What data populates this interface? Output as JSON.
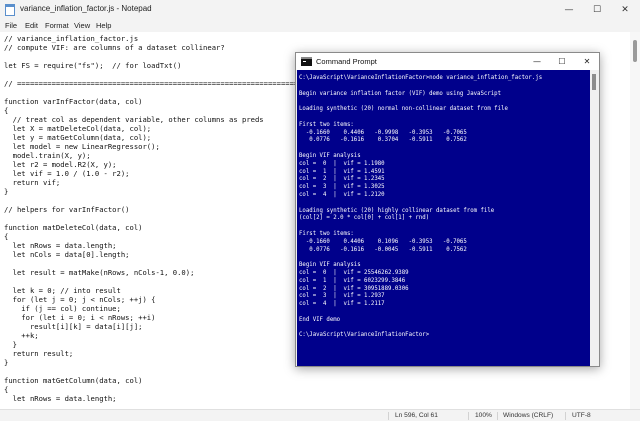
{
  "notepad": {
    "title": "variance_inflation_factor.js - Notepad",
    "menu": [
      "File",
      "Edit",
      "Format",
      "View",
      "Help"
    ],
    "code_lines": [
      "// variance_inflation_factor.js",
      "// compute VIF: are columns of a dataset collinear?",
      "",
      "let FS = require(\"fs\");  // for loadTxt()",
      "",
      "// =================================================================",
      "",
      "function varInfFactor(data, col)",
      "{",
      "  // treat col as dependent variable, other columns as preds",
      "  let X = matDeleteCol(data, col);",
      "  let y = matGetColumn(data, col);",
      "  let model = new LinearRegressor();",
      "  model.train(X, y);",
      "  let r2 = model.R2(X, y);",
      "  let vif = 1.0 / (1.0 - r2);",
      "  return vif;",
      "}",
      "",
      "// helpers for varInfFactor()",
      "",
      "function matDeleteCol(data, col)",
      "{",
      "  let nRows = data.length;",
      "  let nCols = data[0].length;",
      "",
      "  let result = matMake(nRows, nCols-1, 0.0);",
      "",
      "  let k = 0; // into result",
      "  for (let j = 0; j < nCols; ++j) {",
      "    if (j == col) continue;",
      "    for (let i = 0; i < nRows; ++i)",
      "      result[i][k] = data[i][j];",
      "    ++k;",
      "  }",
      "  return result;",
      "}",
      "",
      "function matGetColumn(data, col)",
      "{",
      "  let nRows = data.length;"
    ],
    "status": {
      "position": "Ln 596, Col 61",
      "zoom": "100%",
      "line_ending": "Windows (CRLF)",
      "encoding": "UTF-8"
    },
    "buttons": {
      "minimize": "—",
      "maximize": "☐",
      "close": "✕"
    }
  },
  "cmd": {
    "title": "Command Prompt",
    "console_lines": [
      "C:\\JavaScript\\VarianceInflationFactor>node variance_inflation_factor.js",
      "",
      "Begin variance inflation factor (VIF) demo using JavaScript",
      "",
      "Loading synthetic (20) normal non-collinear dataset from file",
      "",
      "First two items:",
      "  -0.1660    0.4406   -0.9998   -0.3953   -0.7065",
      "   0.0776   -0.1616    0.3704   -0.5911    0.7562",
      "",
      "Begin VIF analysis",
      "col =  0  |  vif = 1.1980",
      "col =  1  |  vif = 1.4591",
      "col =  2  |  vif = 1.2345",
      "col =  3  |  vif = 1.3025",
      "col =  4  |  vif = 1.2120",
      "",
      "Loading synthetic (20) highly collinear dataset from file",
      "(col[2] = 2.0 * col[0] + col[1] + rnd)",
      "",
      "First two items:",
      "  -0.1660    0.4406    0.1096   -0.3953   -0.7065",
      "   0.0776   -0.1616   -0.0045   -0.5911    0.7562",
      "",
      "Begin VIF analysis",
      "col =  0  |  vif = 25546262.9389",
      "col =  1  |  vif = 6023299.3846",
      "col =  2  |  vif = 30951889.0306",
      "col =  3  |  vif = 1.2937",
      "col =  4  |  vif = 1.2117",
      "",
      "End VIF demo",
      "",
      "C:\\JavaScript\\VarianceInflationFactor>"
    ],
    "buttons": {
      "minimize": "—",
      "maximize": "☐",
      "close": "✕"
    }
  },
  "colors": {
    "console_background": "#00008b",
    "console_text": "#ffffff",
    "notepad_chrome": "#f3f3f3"
  }
}
